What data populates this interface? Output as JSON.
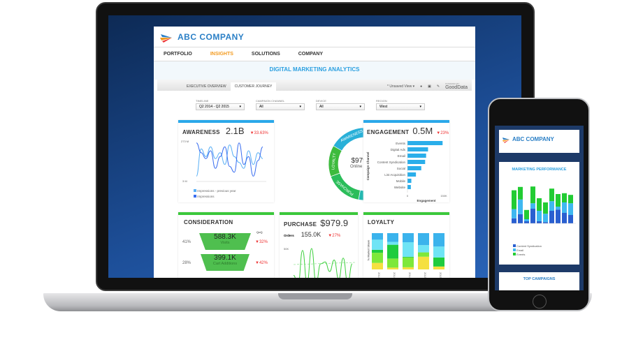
{
  "header": {
    "company": "ABC COMPANY"
  },
  "nav": [
    {
      "label": "PORTFOLIO"
    },
    {
      "label": "INSIGHTS",
      "active": true
    },
    {
      "label": "SOLUTIONS"
    },
    {
      "label": "COMPANY"
    }
  ],
  "page_title": "DIGITAL MARKETING ANALYTICS",
  "tabs": [
    {
      "label": "EXECUTIVE OVERVIEW"
    },
    {
      "label": "CUSTOMER JOURNEY",
      "selected": true
    }
  ],
  "toolbar": {
    "view": "* Unsaved View ▾",
    "brand_small": "POWERED BY",
    "brand": "GoodData"
  },
  "filters": [
    {
      "label": "TIMELINE",
      "value": "Q2 2014 - Q2 2015"
    },
    {
      "label": "CAMPAIGN CHANNEL",
      "value": "All"
    },
    {
      "label": "DEVICE",
      "value": "All"
    },
    {
      "label": "REGION",
      "value": "West"
    }
  ],
  "awareness": {
    "title": "AWARENESS",
    "value": "2.1B",
    "change": "▼33.63%",
    "y_max": "273 M",
    "y_min": "3 M",
    "legend": [
      "Impressions - previous year",
      "Impressions"
    ],
    "series": [
      [
        10,
        80,
        60,
        85,
        55,
        70,
        40,
        90,
        60,
        45,
        30,
        75,
        40,
        70,
        55
      ],
      [
        95,
        70,
        55,
        75,
        30,
        60,
        85,
        35,
        20,
        95,
        40,
        60,
        10,
        50,
        85
      ]
    ]
  },
  "journey": {
    "value": "$979.9 K",
    "label": "Online Revenue",
    "segments": [
      "AWARENESS",
      "ENGAGEMENT",
      "CONSIDERATION",
      "PURCHASE",
      "LOYALTY"
    ]
  },
  "engagement": {
    "title": "ENGAGEMENT",
    "value": "0.5M",
    "change": "▼23%",
    "ylabel": "Campaign Channel",
    "xlabel": "Engagement",
    "x_ticks": [
      "0",
      "150K"
    ],
    "categories": [
      "Events",
      "Digital Ads",
      "Email",
      "Content Syndication",
      "Social",
      "List Acquisition",
      "Mobile",
      "Website"
    ],
    "values": [
      145,
      85,
      77,
      73,
      57,
      35,
      16,
      14
    ]
  },
  "consideration": {
    "title": "CONSIDERATION",
    "qoq": "QoQ",
    "rows": [
      {
        "pct": "41%",
        "value": "588.3K",
        "label": "Visits",
        "change": "▼32%"
      },
      {
        "pct": "28%",
        "value": "399.1K",
        "label": "Cart Additions",
        "change": "▼42%"
      }
    ]
  },
  "purchase": {
    "title": "PURCHASE",
    "value": "$979.9",
    "orders_label": "Orders",
    "orders": "155.0K",
    "change": "▼27%",
    "y_tick": "50K",
    "series": [
      30,
      5,
      95,
      10,
      100,
      10,
      60,
      65,
      40,
      70,
      20,
      75,
      10,
      60
    ]
  },
  "loyalty": {
    "title": "LOYALTY",
    "ylabel": "% Market Share",
    "x_labels": [
      "2014",
      "2014",
      "2014",
      "2015",
      "2015"
    ],
    "colors": [
      "#f5e040",
      "#7ee83a",
      "#1fcc3e",
      "#6fe4f5",
      "#3bb3ec"
    ],
    "stacks": [
      [
        18,
        28,
        8,
        28,
        18
      ],
      [
        5,
        25,
        38,
        8,
        24
      ],
      [
        6,
        27,
        2,
        40,
        25
      ],
      [
        35,
        12,
        0,
        20,
        33
      ],
      [
        8,
        0,
        25,
        30,
        37
      ]
    ]
  },
  "phone": {
    "company": "ABC COMPANY",
    "chart_title": "MARKETING PERFORMANCE",
    "legend": [
      "Content Syndication",
      "Email",
      "Events"
    ],
    "colors": [
      "#2a5fd0",
      "#3fb8f0",
      "#22cc33"
    ],
    "stacks": [
      [
        12,
        22,
        45
      ],
      [
        22,
        35,
        30
      ],
      [
        5,
        5,
        22
      ],
      [
        35,
        13,
        40
      ],
      [
        5,
        25,
        30
      ],
      [
        3,
        20,
        27
      ],
      [
        30,
        23,
        30
      ],
      [
        33,
        7,
        30
      ],
      [
        25,
        25,
        22
      ],
      [
        20,
        28,
        20
      ]
    ],
    "footer": "TOP CAMPAIGNS"
  }
}
